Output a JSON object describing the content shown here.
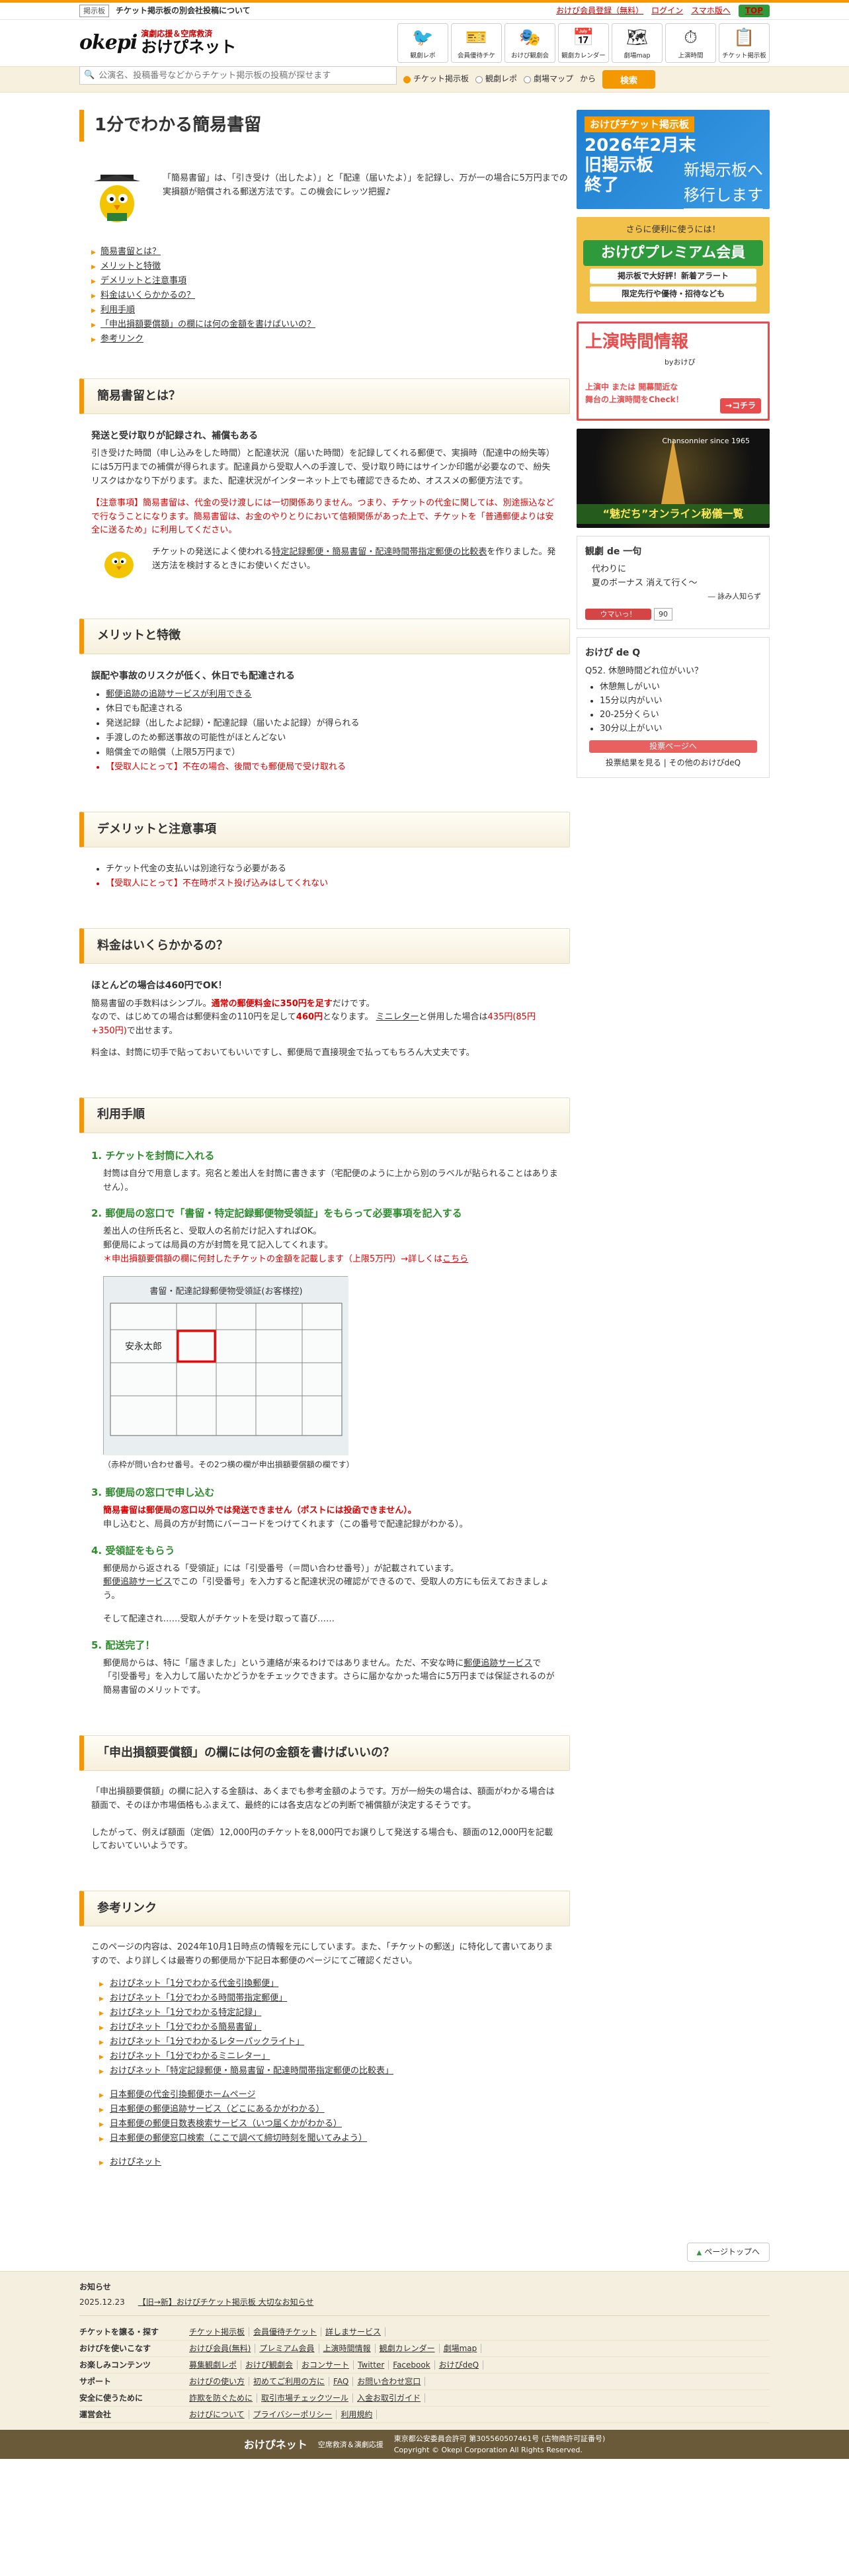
{
  "topbar": {
    "tag": "掲示板",
    "notice": "チケット掲示板の別会社投稿について",
    "links": [
      "おけぴ会員登録（無料）",
      "ログイン",
      "スマホ版へ"
    ],
    "top": "TOP"
  },
  "header": {
    "logo_okepi": "okepi",
    "logo_sub": "演劇応援＆空席救済",
    "logo_main": "おけぴネット",
    "nav": [
      "観劇レポ",
      "会員優待チケ",
      "おけぴ観劇会",
      "観劇カレンダー",
      "劇場map",
      "上演時間",
      "チケット掲示板"
    ]
  },
  "search": {
    "placeholder": "公演名、投稿番号などからチケット掲示板の投稿が探せます",
    "options": [
      "チケット掲示板",
      "観劇レポ",
      "劇場マップ"
    ],
    "from": "から",
    "button": "検索"
  },
  "page": {
    "title": "1分でわかる簡易書留",
    "intro": "「簡易書留」は、「引き受け（出したよ）」と「配達（届いたよ）」を記録し、万が一の場合に5万円までの実損額が賠償される郵送方法です。この機会にレッツ把握♪"
  },
  "toc": [
    "簡易書留とは？",
    "メリットと特徴",
    "デメリットと注意事項",
    "料金はいくらかかるの？",
    "利用手順",
    "「申出損額要償額」の欄には何の金額を書けばいいの？",
    "参考リンク"
  ],
  "sec1": {
    "title": "簡易書留とは？",
    "h": "発送と受け取りが記録され、補償もある",
    "p": "引き受けた時間（申し込みをした時間）と配達状況（届いた時間）を記録してくれる郵便で、実損時（配達中の紛失等）には5万円までの補償が得られます。配達員から受取人への手渡しで、受け取り時にはサインか印鑑が必要なので、紛失リスクはかなり下がります。また、配達状況がインターネット上でも確認できるため、オススメの郵便方法です。",
    "warn": "【注意事項】簡易書留は、代金の受け渡しには一切関係ありません。つまり、チケットの代金に関しては、別途振込などで行なうことになります。簡易書留は、お金のやりとりにおいて信頼関係があった上で、チケットを「普通郵便よりは安全に送るため」に利用してください。",
    "note_pre": "チケットの発送によく使われる",
    "note_link": "特定記録郵便・簡易書留・配達時間帯指定郵便の比較表",
    "note_post": "を作りました。発送方法を検討するときにお使いください。"
  },
  "sec2": {
    "title": "メリットと特徴",
    "h": "誤配や事故のリスクが低く、休日でも配達される",
    "items": [
      "郵便追跡の追跡サービスが利用できる",
      "休日でも配達される",
      "発送記録（出したよ記録）・配達記録（届いたよ記録）が得られる",
      "手渡しのため郵送事故の可能性がほとんどない",
      "賠償金での賠償（上限5万円まで）",
      "【受取人にとって】不在の場合、後間でも郵便局で受け取れる"
    ]
  },
  "sec3": {
    "title": "デメリットと注意事項",
    "items": [
      "チケット代金の支払いは別途行なう必要がある",
      "【受取人にとって】不在時ポスト投げ込みはしてくれない"
    ]
  },
  "sec4": {
    "title": "料金はいくらかかるの？",
    "h": "ほとんどの場合は460円でOK！",
    "p1_a": "簡易書留の手数料はシンプル。",
    "p1_b": "通常の郵便料金に350円を足す",
    "p1_c": "だけです。",
    "p2_a": "なので、はじめての場合は郵便料金の110円を足して",
    "p2_b": "460円",
    "p2_c": "となります。",
    "p2_d": "ミニレター",
    "p2_e": "と併用した場合は",
    "p2_f": "435円(85円+350円)",
    "p2_g": "で出せます。",
    "p3": "料金は、封筒に切手で貼っておいてもいいですし、郵便局で直接現金で払ってもちろん大丈夫です。"
  },
  "sec5": {
    "title": "利用手順",
    "s1_h": "1. チケットを封筒に入れる",
    "s1_p": "封筒は自分で用意します。宛名と差出人を封筒に書きます（宅配便のように上から別のラベルが貼られることはありません）。",
    "s2_h": "2. 郵便局の窓口で「書留・特定記録郵便物受領証」をもらって必要事項を記入する",
    "s2_p1": "差出人の住所氏名と、受取人の名前だけ記入すればOK。",
    "s2_p2": "郵便局によっては局員の方が封筒を見て記入してくれます。",
    "s2_p3": "＊申出損額要償額の欄に何封したチケットの金額を記載します（上限5万円）→詳しくは",
    "s2_link": "こちら",
    "img_title": "書留・配達記録郵便物受領証(お客様控)",
    "img_name": "安永太郎",
    "caption": "（赤枠が問い合わせ番号。その2つ横の欄が申出損額要償額の欄です）",
    "s3_h": "3. 郵便局の窓口で申し込む",
    "s3_warn": "簡易書留は郵便局の窓口以外では発送できません（ポストには投函できません）。",
    "s3_p": "申し込むと、局員の方が封筒にバーコードをつけてくれます（この番号で配達記録がわかる）。",
    "s4_h": "4. 受領証をもらう",
    "s4_p1": "郵便局から返される「受領証」には「引受番号（＝問い合わせ番号）」が記載されています。",
    "s4_link": "郵便追跡サービス",
    "s4_p2": "でこの「引受番号」を入力すると配達状況の確認ができるので、受取人の方にも伝えておきましょう。",
    "s4_p3": "そして配達され……受取人がチケットを受け取って喜び……",
    "s5_h": "5. 配送完了！",
    "s5_p1": "郵便局からは、特に「届きました」という連絡が来るわけではありません。ただ、不安な時に",
    "s5_link": "郵便追跡サービス",
    "s5_p2": "で「引受番号」を入力して届いたかどうかをチェックできます。さらに届かなかった場合に5万円までは保証されるのが簡易書留のメリットです。"
  },
  "sec6": {
    "title": "「申出損額要償額」の欄には何の金額を書けばいいの？",
    "p1": "「申出損額要償額」の欄に記入する金額は、あくまでも参考金額のようです。万が一紛失の場合は、額面がわかる場合は額面で、そのほか市場価格もふまえて、最終的には各支店などの判断で補償額が決定するそうです。",
    "p2": "したがって、例えば額面（定価）12,000円のチケットを8,000円でお譲りして発送する場合も、額面の12,000円を記載しておいていいようです。"
  },
  "sec7": {
    "title": "参考リンク",
    "p": "このページの内容は、2024年10月1日時点の情報を元にしています。また、「チケットの郵送」に特化して書いてありますので、より詳しくは最寄りの郵便局か下記日本郵便のページにてご確認ください。",
    "links1": [
      "おけぴネット「1分でわかる代金引換郵便」",
      "おけぴネット「1分でわかる時間帯指定郵便」",
      "おけぴネット「1分でわかる特定記録」",
      "おけぴネット「1分でわかる簡易書留」",
      "おけぴネット「1分でわかるレターパックライト」",
      "おけぴネット「1分でわかるミニレター」",
      "おけぴネット「特定記録郵便・簡易書留・配達時間帯指定郵便の比較表」"
    ],
    "links2": [
      "日本郵便の代金引換郵便ホームページ",
      "日本郵便の郵便追跡サービス（どこにあるかがわかる）",
      "日本郵便の郵便日数表検索サービス（いつ届くかがわかる）",
      "日本郵便の郵便窓口検索（ここで調べて締切時刻を聞いてみよう）"
    ],
    "links3": [
      "おけぴネット"
    ]
  },
  "side": {
    "b1_t1": "おけぴチケット掲示板",
    "b1_t2": "2026年2月末\n旧掲示板\n終了",
    "b1_t3": "新掲示板へ\n移行します",
    "b2_t1": "さらに便利に使うには！",
    "b2_t2": "おけぴプレミアム会員",
    "b2_t3": "掲示板で大好評！新着アラート",
    "b2_t4": "限定先行や優待・招待なども",
    "b3_t1": "上演時間情報",
    "b3_t2": "byおけぴ",
    "b3_t3": "上演中 または 開幕間近な舞台の上演時間をCheck！",
    "b3_t4": "→コチラ",
    "b4_t1": "Chansonnier since 1965",
    "b4_t2": "“魅だち”オンライン秘儀一覧",
    "q1_title": "観劇 de 一句",
    "q1_text": "代わりに\n夏のボーナス 消えて行く〜",
    "q1_author": "― 詠み人知らず",
    "q1_like": "ウマいっ！",
    "q1_count": "90",
    "q2_title": "おけぴ de Q",
    "q2_q": "Q52. 休憩時間どれ位がいい？",
    "q2_opts": [
      "休憩無しがいい",
      "15分以内がいい",
      "20-25分くらい",
      "30分以上がいい"
    ],
    "q2_vote": "投票ページへ",
    "q2_foot1": "投票結果を見る",
    "q2_foot2": "その他のおけぴdeQ"
  },
  "footer": {
    "pagetop": "ページトップへ",
    "news_h": "お知らせ",
    "news_date": "2025.12.23",
    "news_link": "【旧→新】おけぴチケット掲示板 大切なお知らせ",
    "rows": [
      {
        "h": "チケットを譲る・探す",
        "items": [
          "チケット掲示板",
          "会員優待チケット",
          "詳しまサービス"
        ]
      },
      {
        "h": "おけぴを使いこなす",
        "items": [
          "おけぴ会員(無料)",
          "プレミアム会員",
          "上演時間情報",
          "観劇カレンダー",
          "劇場map"
        ]
      },
      {
        "h": "お楽しみコンテンツ",
        "items": [
          "募集観劇レポ",
          "おけぴ観劇会",
          "おコンサート",
          "Twitter",
          "Facebook",
          "おけぴdeQ"
        ]
      },
      {
        "h": "サポート",
        "items": [
          "おけぴの使い方",
          "初めてご利用の方に",
          "FAQ",
          "お問い合わせ窓口"
        ]
      },
      {
        "h": "安全に使うために",
        "items": [
          "詐欺を防ぐために",
          "取引市場チェックツール",
          "入金お取引ガイド"
        ]
      },
      {
        "h": "運営会社",
        "items": [
          "おけぴについて",
          "プライバシーポリシー",
          "利用規約"
        ]
      }
    ],
    "brand": "おけぴネット",
    "brand_sub": "空席救済＆演劇応援",
    "company": "東京都公安委員会許可 第305560507461号 (古物商許可証番号)",
    "copyright": "Copyright © Okepi Corporation All Rights Reserved."
  }
}
